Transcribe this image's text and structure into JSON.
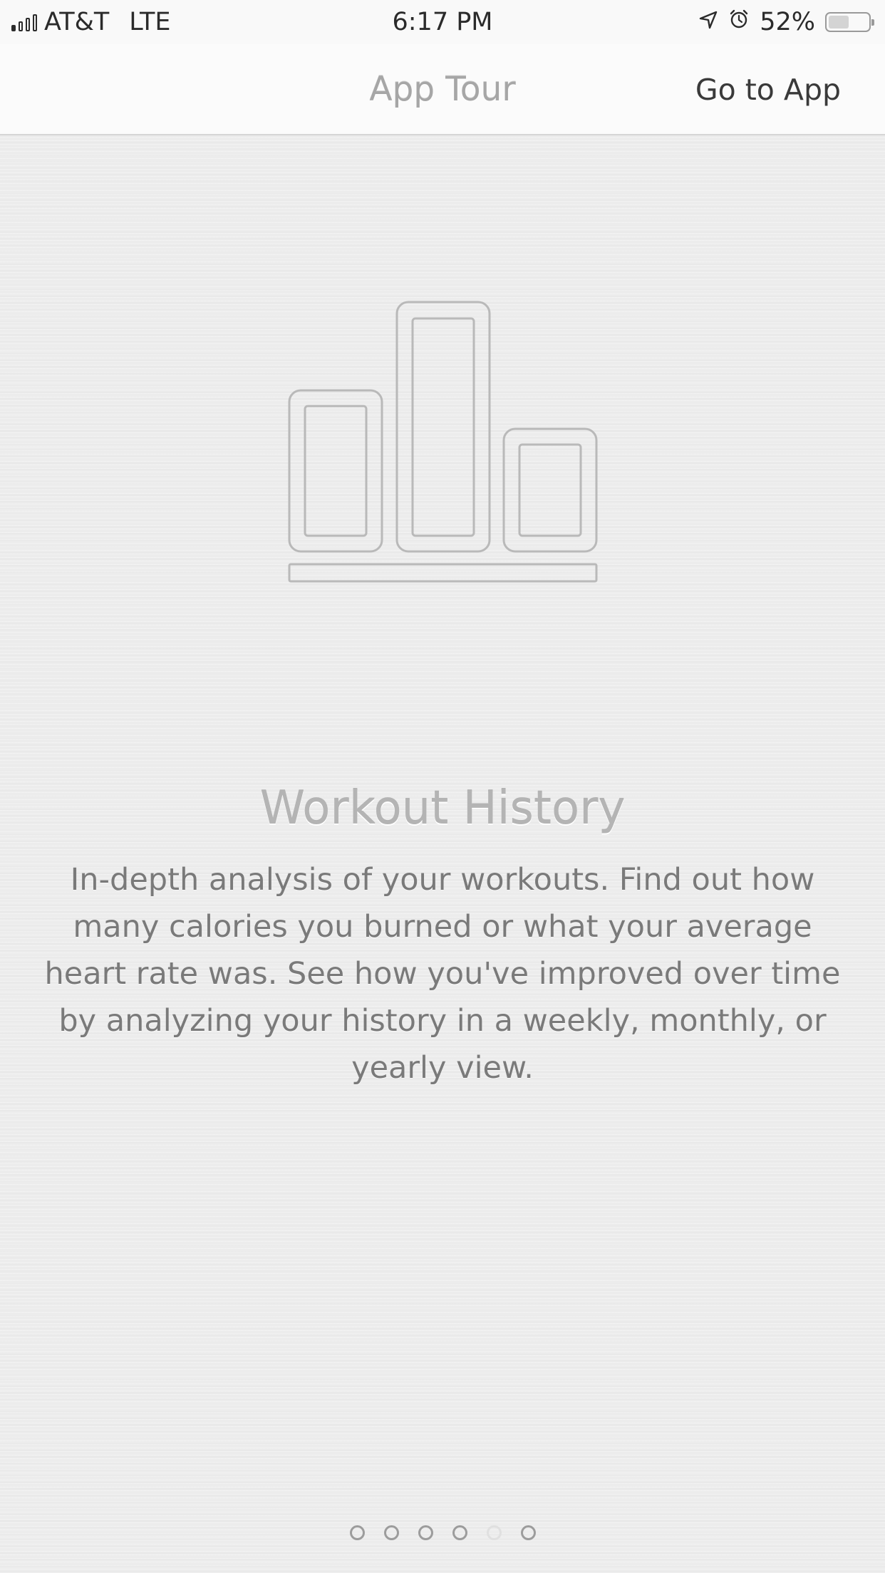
{
  "status_bar": {
    "carrier": "AT&T",
    "network": "LTE",
    "time": "6:17 PM",
    "battery_percent": "52%",
    "battery_level": 0.52,
    "signal_bars_filled": 1,
    "signal_bars_total": 4,
    "icons": [
      "signal-icon",
      "location-arrow-icon",
      "alarm-icon",
      "battery-icon"
    ]
  },
  "nav": {
    "title": "App Tour",
    "action_label": "Go to App"
  },
  "page": {
    "illustration_icon": "bar-chart-icon",
    "title": "Workout History",
    "description": "In-depth analysis of your workouts. Find out how many calories you burned or what your average heart rate was. See how you've improved over time by analyzing your history in a weekly, monthly, or yearly view."
  },
  "pagination": {
    "total_pages": 6,
    "current_page": 5
  },
  "colors": {
    "background": "#ececec",
    "nav_background": "#fbfbfb",
    "icon_stroke": "#b9b9b9",
    "text": "#7a7a7a"
  }
}
